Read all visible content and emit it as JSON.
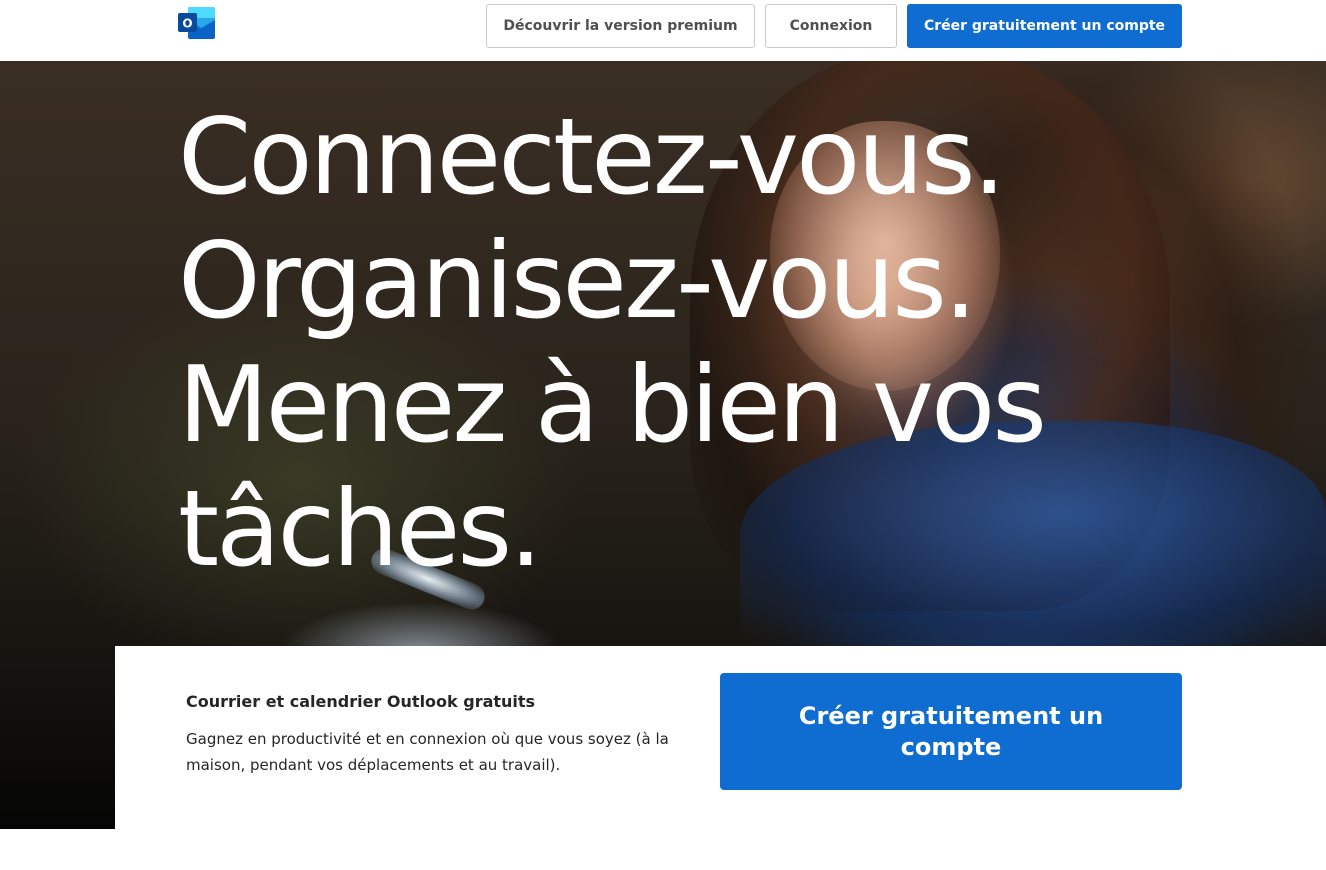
{
  "header": {
    "logo_letter": "O",
    "premium_label": "Découvrir la version premium",
    "login_label": "Connexion",
    "create_label": "Créer gratuitement un compte"
  },
  "hero": {
    "headline_lines": [
      "Connectez-vous.",
      "Organisez-vous.",
      "Menez à bien vos",
      "tâches."
    ]
  },
  "panel": {
    "title": "Courrier et calendrier Outlook gratuits",
    "description": "Gagnez en productivité et en connexion où que vous soyez (à la maison, pendant vos déplacements et au travail).",
    "cta_label": "Créer gratuitement un compte"
  },
  "colors": {
    "brand_blue": "#0f6cd0",
    "outlook_dark_blue": "#0a4a9c",
    "outlook_light_blue": "#28a8ea"
  },
  "icons": {
    "logo": "outlook-logo-icon"
  }
}
